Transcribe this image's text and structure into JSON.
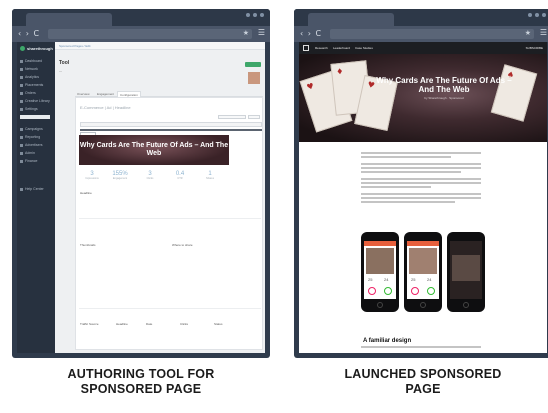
{
  "captions": {
    "left_line1": "AUTHORING TOOL FOR",
    "left_line2": "SPONSORED PAGE",
    "right_line1": "LAUNCHED SPONSORED",
    "right_line2": "PAGE"
  },
  "browser": {
    "nav_arrows": "‹ › C",
    "star": "★",
    "menu": "☰"
  },
  "authoring": {
    "brand": "sharethrough",
    "sidebar_items": [
      "Dashboard",
      "Network",
      "Analytics",
      "Placements",
      "Orders",
      "Creative Library",
      "Settings"
    ],
    "sidebar_items2": [
      "Campaigns",
      "Reporting",
      "Advertisers",
      "Admin",
      "Finance"
    ],
    "sidebar_bottom": "Help Center",
    "crumb": "Sponsored Pages  /  Edit",
    "title": "Tool",
    "tabs": [
      "Overview",
      "Engagement",
      "Configuration"
    ],
    "headline_placeholder": "E-Commerce | Ad | Headline",
    "hero_title": "Why Cards Are The Future Of Ads – And The Web",
    "stats": [
      {
        "value": "3",
        "label": "Impressions"
      },
      {
        "value": "155%",
        "label": "Engagement"
      },
      {
        "value": "3",
        "label": "Clicks"
      },
      {
        "value": "0.4",
        "label": "CTR"
      },
      {
        "value": "1",
        "label": "Shares"
      }
    ],
    "section_label": "Headline",
    "section_label2": "Thumbnails",
    "section_label3": "Where to share",
    "footer_cols": [
      "Traffic Source",
      "Headline",
      "Date",
      "Clicks",
      "Status"
    ]
  },
  "launched": {
    "nav": [
      "Research",
      "Leaderboard",
      "Case Studies"
    ],
    "nav_right": "SUBSCRIBE",
    "hero_title": "Why Cards Are The Future Of Ads – And The Web",
    "hero_sub": "by Sharethrough · Sponsored",
    "section_heading": "A familiar design",
    "phone_screens": [
      {
        "brand": "Tinder",
        "metric1": "25",
        "metric2": "24"
      },
      {
        "brand": "Tinder",
        "metric1": "25",
        "metric2": "24"
      },
      {
        "brand": "It's a Match!",
        "metric1": "",
        "metric2": ""
      }
    ]
  }
}
